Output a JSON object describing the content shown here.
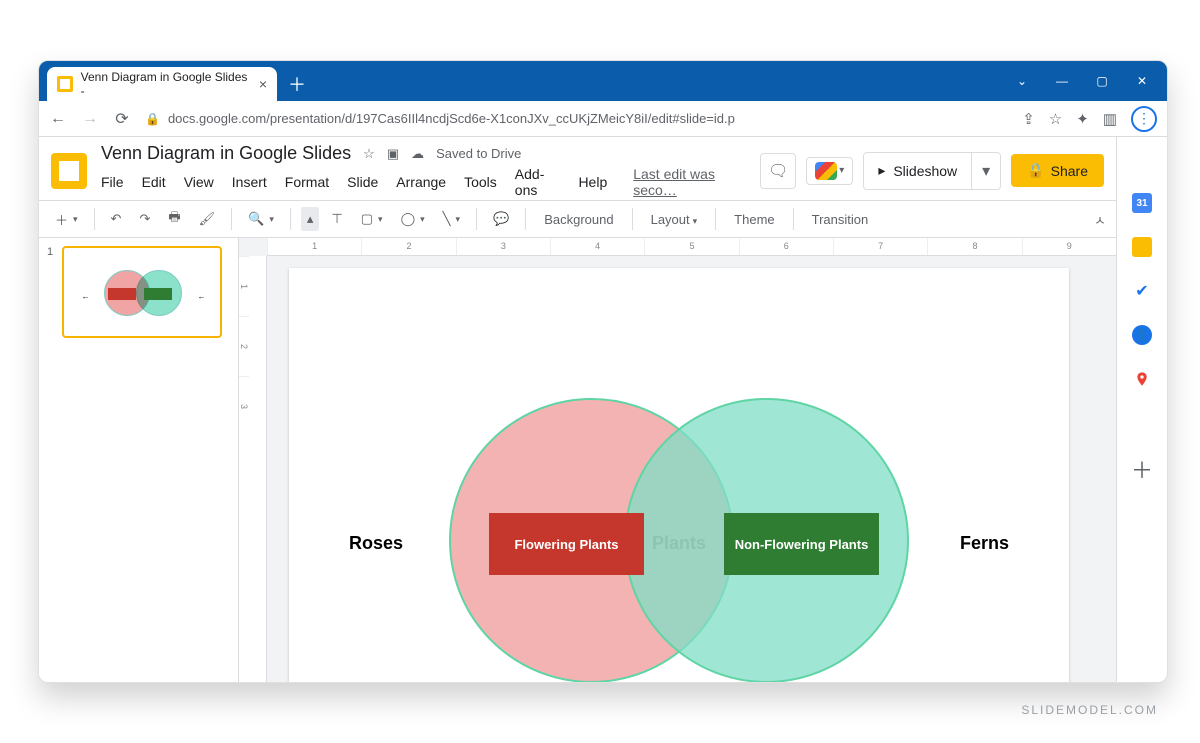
{
  "browser": {
    "tab_title": "Venn Diagram in Google Slides - ",
    "url": "docs.google.com/presentation/d/197Cas6IIl4ncdjScd6e-X1conJXv_ccUKjZMeicY8iI/edit#slide=id.p"
  },
  "doc": {
    "title": "Venn Diagram in Google Slides",
    "saved_status": "Saved to Drive",
    "last_edit": "Last edit was seco…",
    "slideshow": "Slideshow",
    "share": "Share"
  },
  "menus": [
    "File",
    "Edit",
    "View",
    "Insert",
    "Format",
    "Slide",
    "Arrange",
    "Tools",
    "Add-ons",
    "Help"
  ],
  "toolbar": {
    "background": "Background",
    "layout": "Layout",
    "theme": "Theme",
    "transition": "Transition"
  },
  "filmstrip": {
    "slide_number": "1"
  },
  "ruler_h": [
    "1",
    "2",
    "3",
    "4",
    "5",
    "6",
    "7",
    "8",
    "9"
  ],
  "ruler_v": [
    "1",
    "2",
    "3"
  ],
  "slide": {
    "left_label": "Roses",
    "right_label": "Ferns",
    "center_label": "Plants",
    "left_box": "Flowering Plants",
    "right_box": "Non-Flowering Plants"
  },
  "sidepanel": {
    "calendar_day": "31"
  },
  "watermark": "SLIDEMODEL.COM"
}
